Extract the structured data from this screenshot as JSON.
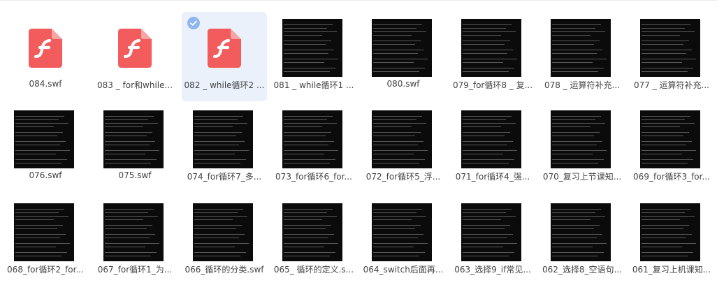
{
  "colors": {
    "selection_bg": "#eaf1fb",
    "flash_icon": "#f25c5c",
    "thumbnail_bg": "#0b0b0b"
  },
  "files": [
    {
      "name": "084.swf",
      "type": "flash"
    },
    {
      "name": "083 _ for和while...",
      "type": "flash"
    },
    {
      "name": "082 _ while循环2 ...",
      "type": "flash",
      "selected": true
    },
    {
      "name": "081 _ while循环1 ...",
      "type": "video"
    },
    {
      "name": "080.swf",
      "type": "video"
    },
    {
      "name": "079_for循环8 _ 复...",
      "type": "video"
    },
    {
      "name": "078 _ 运算符补充...",
      "type": "video"
    },
    {
      "name": "077 _ 运算符补充...",
      "type": "video"
    },
    {
      "name": "076.swf",
      "type": "video"
    },
    {
      "name": "075.swf",
      "type": "video"
    },
    {
      "name": "074_for循环7_多...",
      "type": "video"
    },
    {
      "name": "073_for循环6_for...",
      "type": "video"
    },
    {
      "name": "072_for循环5_浮...",
      "type": "video"
    },
    {
      "name": "071_for循环4_强...",
      "type": "video"
    },
    {
      "name": "070_复习上节课知...",
      "type": "video"
    },
    {
      "name": "069_for循环3_for...",
      "type": "video"
    },
    {
      "name": "068_for循环2_for...",
      "type": "video"
    },
    {
      "name": "067_for循环1_为...",
      "type": "video"
    },
    {
      "name": "066_循环的分类.swf",
      "type": "video"
    },
    {
      "name": "065_ 循环的定义.s...",
      "type": "video"
    },
    {
      "name": "064_switch后面再...",
      "type": "video"
    },
    {
      "name": "063_选择9_if常见...",
      "type": "video"
    },
    {
      "name": "062_选择8_空语句...",
      "type": "video"
    },
    {
      "name": "061_复习上机课知...",
      "type": "video"
    }
  ]
}
